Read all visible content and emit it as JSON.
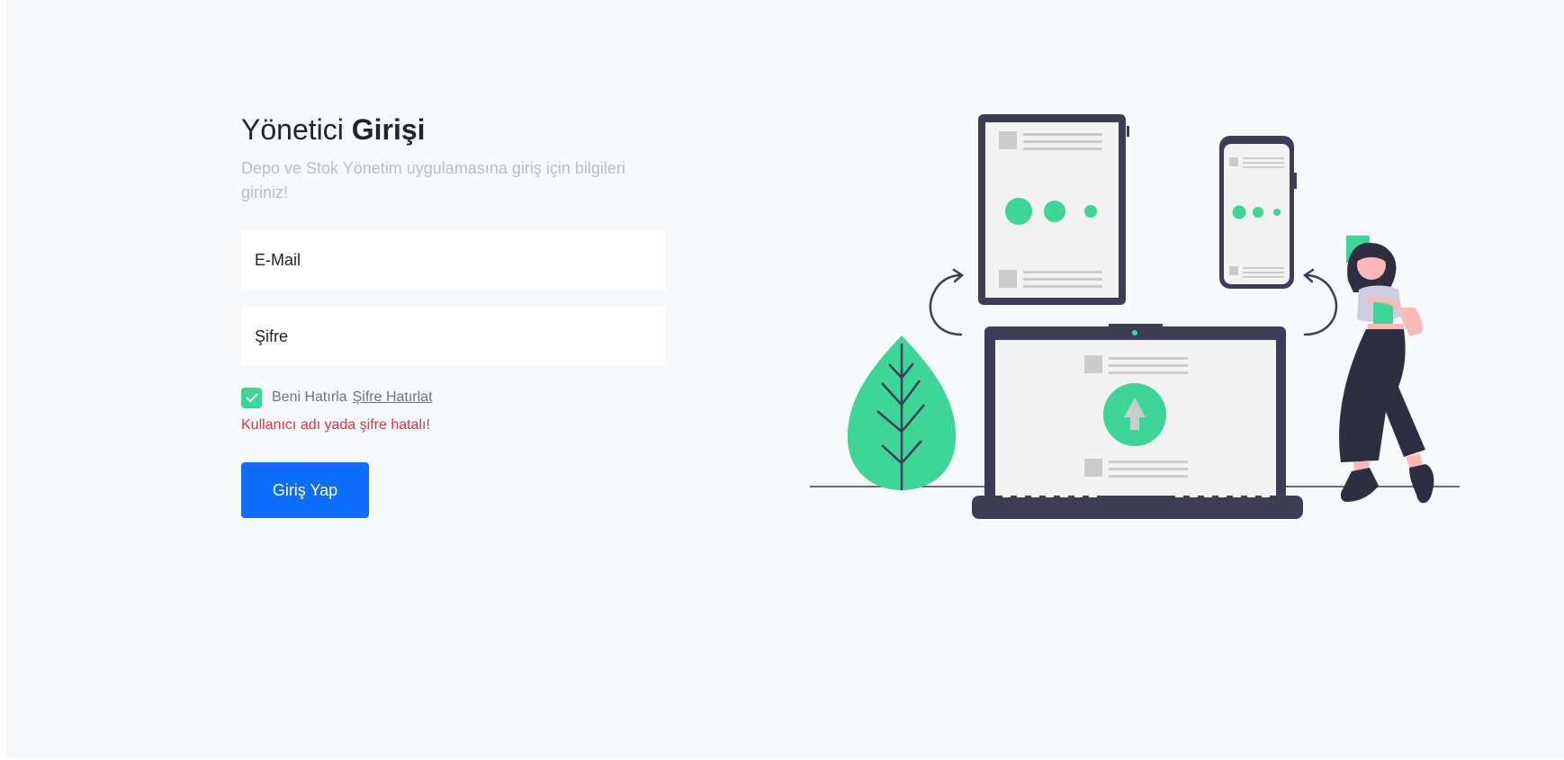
{
  "login": {
    "title_regular": "Yönetici",
    "title_bold": "Girişi",
    "subtitle": "Depo ve Stok Yönetim uygulamasına giriş için bilgileri giriniz!",
    "email_placeholder": "E-Mail",
    "email_value": "",
    "password_placeholder": "Şifre",
    "password_value": "",
    "remember_checked": true,
    "remember_label": "Beni Hatırla",
    "forgot_link": "Şifre Hatırlat",
    "error_message": "Kullanıcı adı yada şifre hatalı!",
    "submit_label": "Giriş Yap"
  },
  "colors": {
    "accent_green": "#3dd598",
    "primary_blue": "#0d6efd",
    "error_red": "#dc3545",
    "device_dark": "#3f3d56"
  },
  "icons": {
    "checkbox": "check-icon"
  }
}
